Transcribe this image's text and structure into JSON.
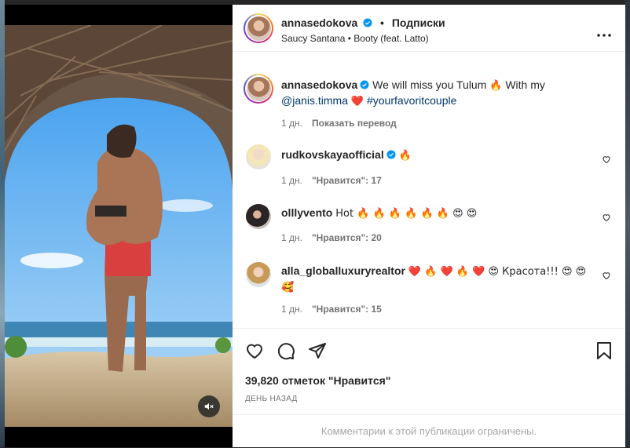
{
  "post": {
    "username": "annasedokova",
    "follow_label": "Подписки",
    "audio": "Saucy Santana • Booty (feat. Latto)"
  },
  "caption": {
    "username": "annasedokova",
    "text_part1": "We will miss you Tulum",
    "emoji1": "🔥",
    "text_part2": "With my",
    "mention": "@janis.timma",
    "emoji2": "❤️",
    "hashtag": "#yourfavoritcouple",
    "time": "1 дн.",
    "translate": "Показать перевод"
  },
  "comments": [
    {
      "username": "rudkovskayaofficial",
      "text": "🔥",
      "time": "1 дн.",
      "likes": "\"Нравится\": 17"
    },
    {
      "username": "olllyvento",
      "text": "Hot 🔥 🔥 🔥 🔥 🔥 🔥 😍 😍",
      "time": "1 дн.",
      "likes": "\"Нравится\": 20"
    },
    {
      "username": "alla_globalluxuryrealtor",
      "text": "❤️ 🔥 ❤️ 🔥 ❤️ 😍 Красота!!! 😍 😍 🥰",
      "time": "1 дн.",
      "likes": "\"Нравится\": 15"
    }
  ],
  "likes_label": "39,820 отметок \"Нравится\"",
  "date_label": "ДЕНЬ НАЗАД",
  "comments_limited": "Комментарии к этой публикации ограничены.",
  "colors": {
    "verified": "#0095f6",
    "heart": "#ed4956",
    "link": "#00376b",
    "muted": "#737373"
  },
  "icons": [
    "heart-icon",
    "comment-icon",
    "share-icon",
    "bookmark-icon",
    "more-icon",
    "mute-icon",
    "verified-icon"
  ]
}
